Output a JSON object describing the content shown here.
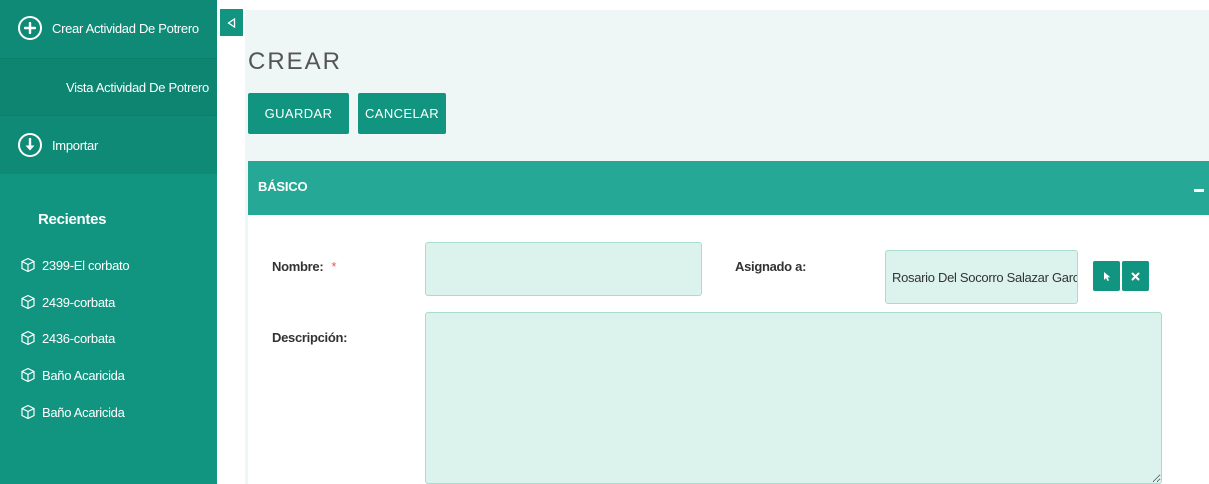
{
  "sidebar": {
    "create_label": "Crear Actividad De Potrero",
    "view_label": "Vista Actividad De Potrero",
    "import_label": "Importar",
    "recent_title": "Recientes",
    "recent_items": [
      {
        "label": "2399-El corbato"
      },
      {
        "label": "2439-corbata"
      },
      {
        "label": "2436-corbata"
      },
      {
        "label": "Baño Acaricida"
      },
      {
        "label": "Baño Acaricida"
      }
    ]
  },
  "page": {
    "title": "CREAR",
    "save_label": "GUARDAR",
    "cancel_label": "CANCELAR"
  },
  "panel": {
    "title": "BÁSICO",
    "fields": {
      "nombre_label": "Nombre:",
      "required_mark": "*",
      "nombre_value": "",
      "asignado_label": "Asignado a:",
      "asignado_value": "Rosario Del Socorro Salazar Garc",
      "descripcion_label": "Descripción:",
      "descripcion_value": ""
    }
  },
  "colors": {
    "sidebar": "#119580",
    "accent": "#26a896",
    "field_bg": "#dcf3ed",
    "main_bg": "#eef7f6"
  },
  "icons": {
    "create": "plus-circle-icon",
    "import": "arrow-down-circle-icon",
    "recent": "cube-icon",
    "collapse_sidebar": "triangle-left-icon",
    "select": "cursor-arrow-icon",
    "clear": "close-icon"
  }
}
